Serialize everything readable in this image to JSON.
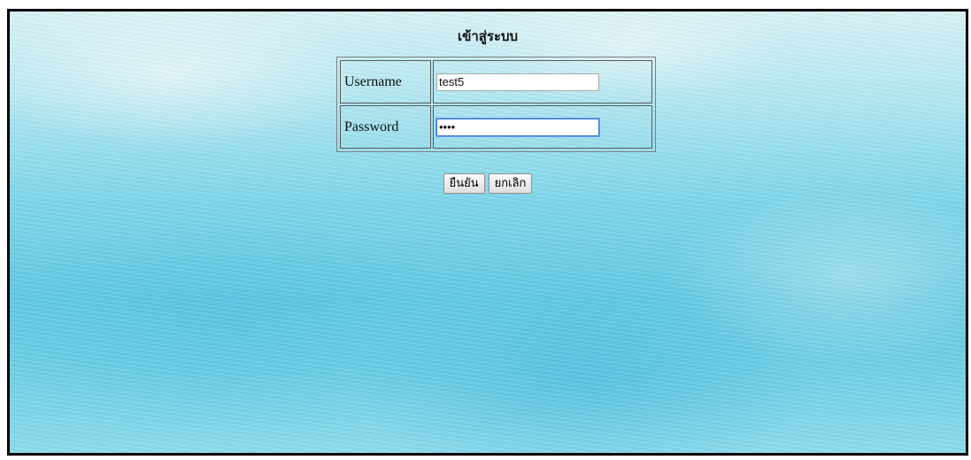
{
  "page": {
    "title": "เข้าสู่ระบบ"
  },
  "form": {
    "username_label": "Username",
    "username_value": "test5",
    "password_label": "Password",
    "password_value": "••••"
  },
  "buttons": {
    "confirm_label": "ยืนยัน",
    "cancel_label": "ยกเลิก"
  },
  "colors": {
    "background_top": "#d8f3f8",
    "background_bottom": "#6ed0e7",
    "focus_border": "#3b78d8"
  }
}
